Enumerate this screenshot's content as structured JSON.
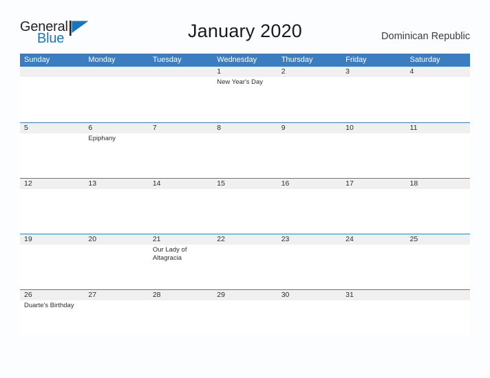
{
  "brand": {
    "name_part1": "General",
    "name_part2": "Blue",
    "accent_color": "#1a75bc"
  },
  "header": {
    "title": "January 2020",
    "country": "Dominican Republic"
  },
  "calendar": {
    "header_color": "#3b7dc0",
    "band_color": "#f0f0f0",
    "weekdays": [
      "Sunday",
      "Monday",
      "Tuesday",
      "Wednesday",
      "Thursday",
      "Friday",
      "Saturday"
    ],
    "weeks": [
      [
        {
          "date": "",
          "event": ""
        },
        {
          "date": "",
          "event": ""
        },
        {
          "date": "",
          "event": ""
        },
        {
          "date": "1",
          "event": "New Year's Day"
        },
        {
          "date": "2",
          "event": ""
        },
        {
          "date": "3",
          "event": ""
        },
        {
          "date": "4",
          "event": ""
        }
      ],
      [
        {
          "date": "5",
          "event": ""
        },
        {
          "date": "6",
          "event": "Epiphany"
        },
        {
          "date": "7",
          "event": ""
        },
        {
          "date": "8",
          "event": ""
        },
        {
          "date": "9",
          "event": ""
        },
        {
          "date": "10",
          "event": ""
        },
        {
          "date": "11",
          "event": ""
        }
      ],
      [
        {
          "date": "12",
          "event": ""
        },
        {
          "date": "13",
          "event": ""
        },
        {
          "date": "14",
          "event": ""
        },
        {
          "date": "15",
          "event": ""
        },
        {
          "date": "16",
          "event": ""
        },
        {
          "date": "17",
          "event": ""
        },
        {
          "date": "18",
          "event": ""
        }
      ],
      [
        {
          "date": "19",
          "event": ""
        },
        {
          "date": "20",
          "event": ""
        },
        {
          "date": "21",
          "event": "Our Lady of Altagracia"
        },
        {
          "date": "22",
          "event": ""
        },
        {
          "date": "23",
          "event": ""
        },
        {
          "date": "24",
          "event": ""
        },
        {
          "date": "25",
          "event": ""
        }
      ],
      [
        {
          "date": "26",
          "event": "Duarte's Birthday"
        },
        {
          "date": "27",
          "event": ""
        },
        {
          "date": "28",
          "event": ""
        },
        {
          "date": "29",
          "event": ""
        },
        {
          "date": "30",
          "event": ""
        },
        {
          "date": "31",
          "event": ""
        },
        {
          "date": "",
          "event": ""
        }
      ]
    ]
  }
}
